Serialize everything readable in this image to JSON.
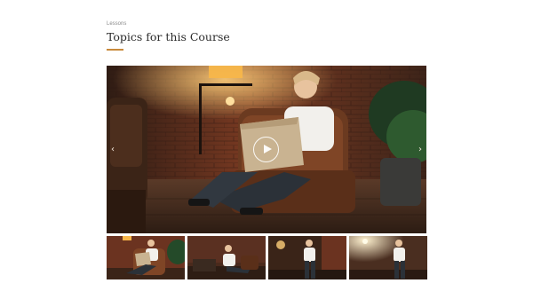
{
  "header": {
    "eyebrow": "Lessons",
    "title": "Topics for this Course"
  },
  "player": {
    "prev_icon": "chevron-left-icon",
    "next_icon": "chevron-right-icon",
    "play_icon": "play-icon",
    "prev_glyph": "‹",
    "next_glyph": "›"
  },
  "thumbnails": [
    {
      "name": "woman-reading-in-chair"
    },
    {
      "name": "woman-sitting-by-table"
    },
    {
      "name": "woman-standing-in-studio"
    },
    {
      "name": "woman-standing-with-lamp"
    }
  ],
  "colors": {
    "accent": "#c98a3c",
    "title": "#2b2b2b",
    "eyebrow": "#8a8a8a"
  }
}
